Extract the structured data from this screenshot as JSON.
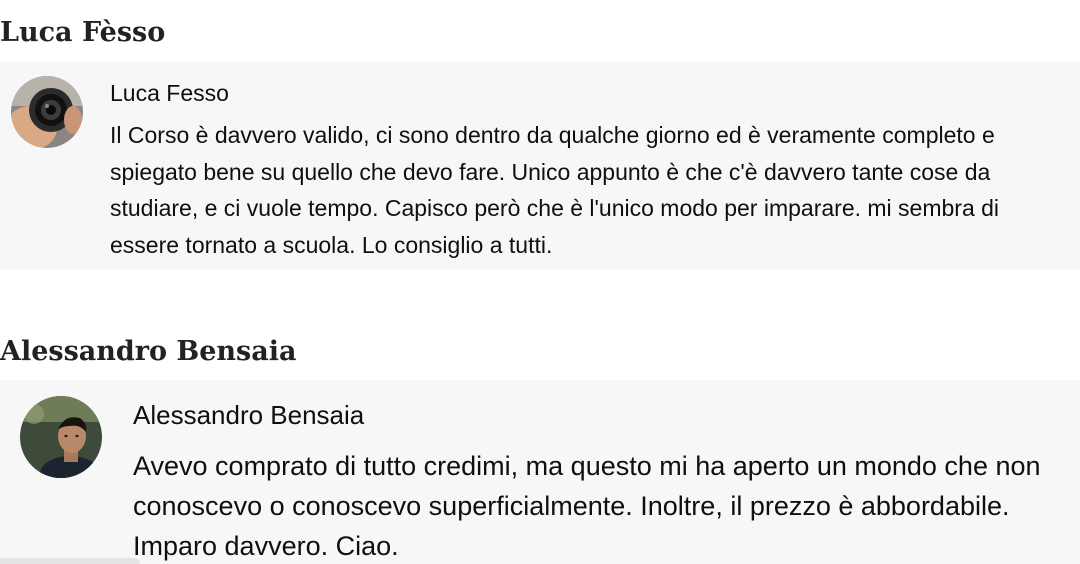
{
  "reviews": [
    {
      "heading": "Luca Fèsso",
      "author": "Luca Fesso",
      "avatar_icon": "camera-lens-photo",
      "comment_lines": [
        "Il Corso è davvero valido, ci sono dentro da qualche giorno ed è veramente completo e",
        "spiegato bene su quello che devo fare. Unico appunto è che c'è davvero tante cose da",
        "studiare, e ci vuole tempo. Capisco però che è l'unico modo per imparare. mi sembra di",
        "essere tornato a scuola. Lo consiglio a tutti."
      ]
    },
    {
      "heading": "Alessandro Bensaia",
      "author": "Alessandro Bensaia",
      "avatar_icon": "person-portrait-photo",
      "comment_lines": [
        "Avevo comprato di tutto credimi, ma questo mi ha aperto un mondo che non",
        "conoscevo o conoscevo superficialmente. Inoltre, il prezzo è abbordabile.",
        "Imparo davvero. Ciao."
      ]
    }
  ],
  "colors": {
    "card_background": "#f7f7f7",
    "text": "#0f0f0f",
    "heading": "#222222"
  }
}
